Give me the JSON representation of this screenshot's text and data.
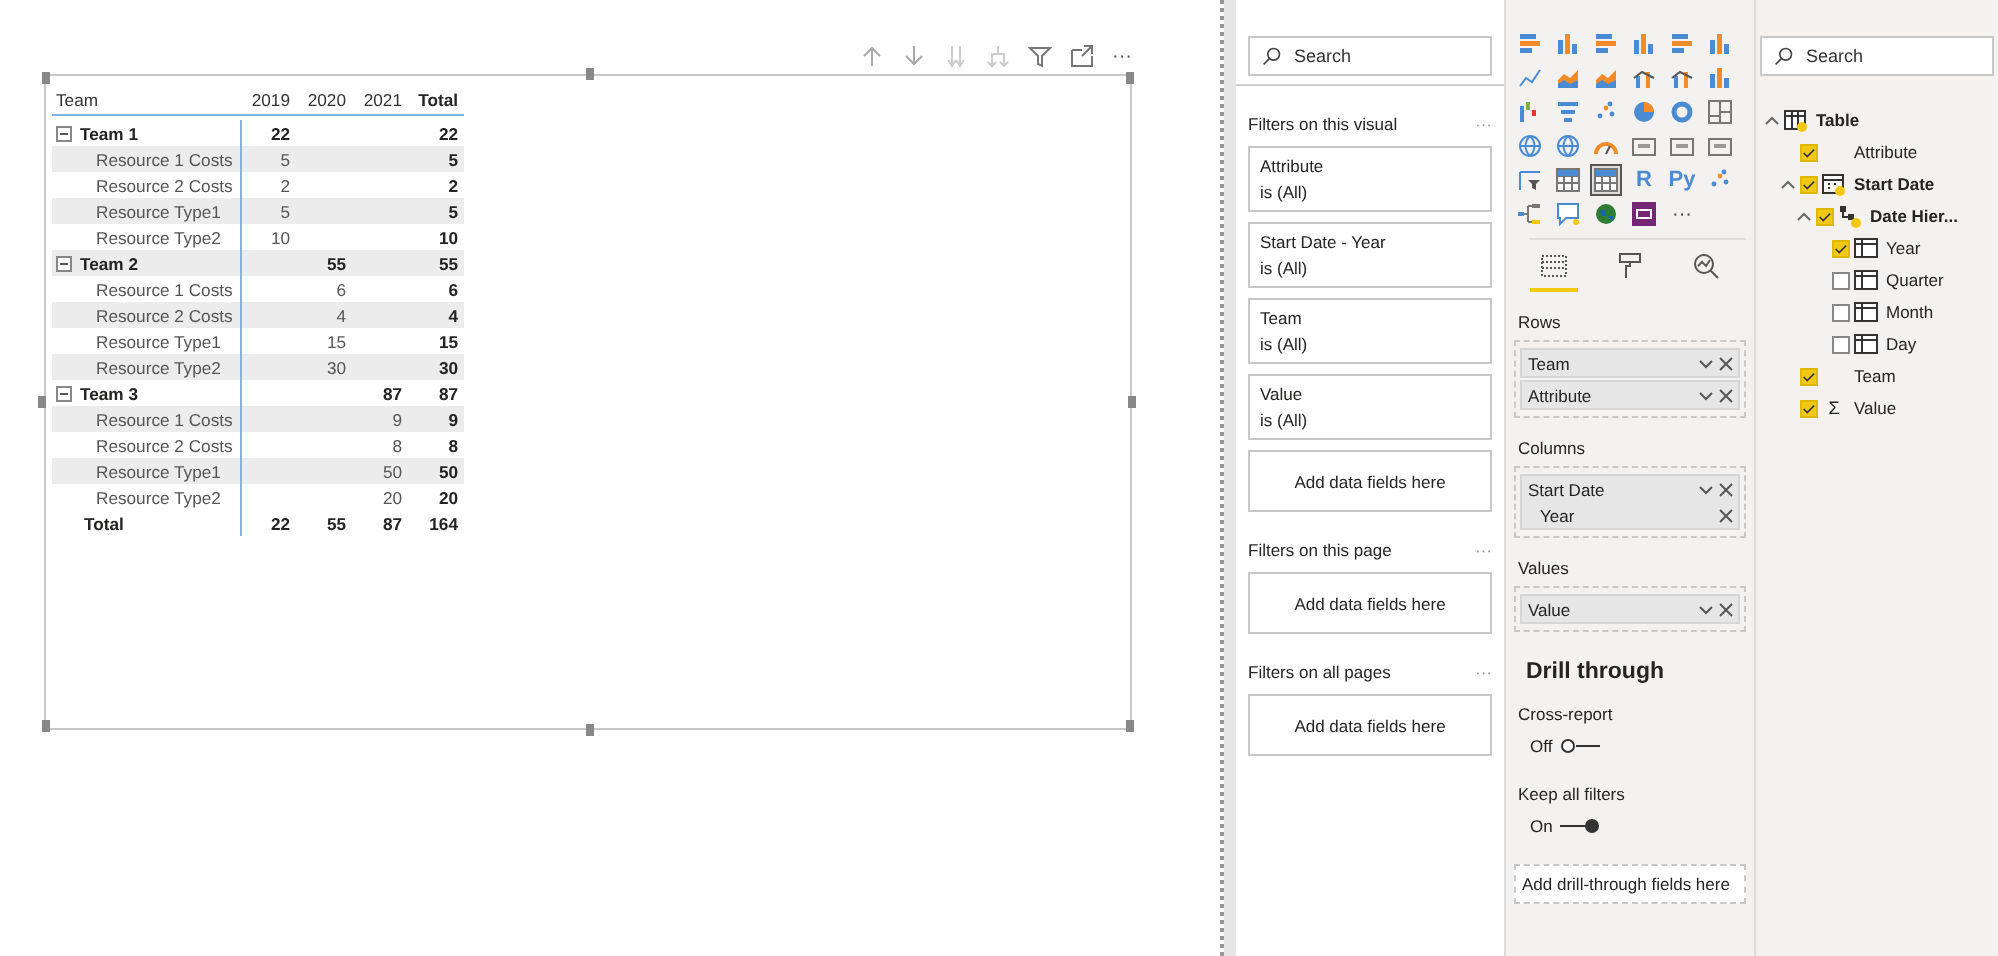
{
  "visual_header": [
    {
      "kind": "up"
    },
    {
      "kind": "down"
    },
    {
      "kind": "double-down"
    },
    {
      "kind": "fork"
    },
    {
      "kind": "filter"
    },
    {
      "kind": "focus"
    },
    {
      "kind": "more",
      "label": "···"
    }
  ],
  "matrix": {
    "columns": [
      "Team",
      "2019",
      "2020",
      "2021",
      "Total"
    ],
    "rows": [
      {
        "kind": "group",
        "label": "Team 1",
        "expanded": true,
        "values": {
          "col_1": "22",
          "total": "22"
        }
      },
      {
        "kind": "item",
        "label": "Resource 1 Costs",
        "values": {
          "col_1": "5",
          "total": "5"
        }
      },
      {
        "kind": "item",
        "label": "Resource 2 Costs",
        "values": {
          "col_1": "2",
          "total": "2"
        }
      },
      {
        "kind": "item",
        "label": "Resource Type1",
        "values": {
          "col_1": "5",
          "total": "5"
        }
      },
      {
        "kind": "item",
        "label": "Resource Type2",
        "values": {
          "col_1": "10",
          "total": "10"
        }
      },
      {
        "kind": "group",
        "label": "Team 2",
        "expanded": true,
        "values": {
          "col_2": "55",
          "total": "55"
        }
      },
      {
        "kind": "item",
        "label": "Resource 1 Costs",
        "values": {
          "col_2": "6",
          "total": "6"
        }
      },
      {
        "kind": "item",
        "label": "Resource 2 Costs",
        "values": {
          "col_2": "4",
          "total": "4"
        }
      },
      {
        "kind": "item",
        "label": "Resource Type1",
        "values": {
          "col_2": "15",
          "total": "15"
        }
      },
      {
        "kind": "item",
        "label": "Resource Type2",
        "values": {
          "col_2": "30",
          "total": "30"
        }
      },
      {
        "kind": "group",
        "label": "Team 3",
        "expanded": true,
        "values": {
          "col_3": "87",
          "total": "87"
        }
      },
      {
        "kind": "item",
        "label": "Resource 1 Costs",
        "values": {
          "col_3": "9",
          "total": "9"
        }
      },
      {
        "kind": "item",
        "label": "Resource 2 Costs",
        "values": {
          "col_3": "8",
          "total": "8"
        }
      },
      {
        "kind": "item",
        "label": "Resource Type1",
        "values": {
          "col_3": "50",
          "total": "50"
        }
      },
      {
        "kind": "item",
        "label": "Resource Type2",
        "values": {
          "col_3": "20",
          "total": "20"
        }
      },
      {
        "kind": "total",
        "label": "Total",
        "values": {
          "col_1": "22",
          "col_2": "55",
          "col_3": "87",
          "total": "164"
        }
      }
    ]
  },
  "filters": {
    "search": {
      "placeholder": "Search"
    },
    "sections": [
      {
        "title": "Filters on this visual",
        "more": "···",
        "cards": [
          {
            "name": "Attribute",
            "state": "is (All)"
          },
          {
            "name": "Start Date - Year",
            "state": "is (All)"
          },
          {
            "name": "Team",
            "state": "is (All)"
          },
          {
            "name": "Value",
            "state": "is (All)"
          }
        ],
        "add": "Add data fields here"
      },
      {
        "title": "Filters on this page",
        "more": "···",
        "add": "Add data fields here"
      },
      {
        "title": "Filters on all pages",
        "more": "···",
        "add": "Add data fields here"
      }
    ]
  },
  "visualizations": {
    "types": [
      {
        "kind": "hbar",
        "selected": false
      },
      {
        "kind": "column",
        "selected": false
      },
      {
        "kind": "hbar",
        "selected": false
      },
      {
        "kind": "column",
        "selected": false
      },
      {
        "kind": "hbar",
        "selected": false
      },
      {
        "kind": "column",
        "selected": false
      },
      {
        "kind": "line",
        "selected": false
      },
      {
        "kind": "area",
        "selected": false
      },
      {
        "kind": "area",
        "selected": false
      },
      {
        "kind": "combo",
        "selected": false
      },
      {
        "kind": "combo",
        "selected": false
      },
      {
        "kind": "column",
        "selected": false
      },
      {
        "kind": "waterfall",
        "selected": false
      },
      {
        "kind": "funnel",
        "selected": false
      },
      {
        "kind": "scatter",
        "selected": false
      },
      {
        "kind": "pie",
        "selected": false
      },
      {
        "kind": "donut",
        "selected": false
      },
      {
        "kind": "treemap",
        "selected": false
      },
      {
        "kind": "map",
        "selected": false
      },
      {
        "kind": "map",
        "selected": false
      },
      {
        "kind": "gauge",
        "selected": false
      },
      {
        "kind": "card",
        "selected": false
      },
      {
        "kind": "card",
        "selected": false
      },
      {
        "kind": "card",
        "selected": false
      },
      {
        "kind": "slicer",
        "selected": false
      },
      {
        "kind": "table",
        "selected": false
      },
      {
        "kind": "table",
        "selected": true
      },
      {
        "kind": "text",
        "label": "R",
        "selected": false
      },
      {
        "kind": "text",
        "label": "Py",
        "selected": false
      },
      {
        "kind": "scatter",
        "selected": false
      },
      {
        "kind": "tree",
        "selected": false
      },
      {
        "kind": "chat",
        "selected": false
      },
      {
        "kind": "globe",
        "selected": false
      },
      {
        "kind": "custom",
        "selected": false
      },
      {
        "kind": "more",
        "label": "···",
        "selected": false
      }
    ],
    "tabs": [
      {
        "kind": "fields",
        "selected": true
      },
      {
        "kind": "format",
        "selected": false
      },
      {
        "kind": "analytics",
        "selected": false
      }
    ],
    "wells": [
      {
        "title": "Rows",
        "fields": [
          {
            "name": "Team"
          },
          {
            "name": "Attribute"
          }
        ]
      },
      {
        "title": "Columns",
        "fields": [
          {
            "name": "Start Date",
            "sub": "Year"
          }
        ]
      },
      {
        "title": "Values",
        "fields": [
          {
            "name": "Value"
          }
        ]
      }
    ],
    "drill_through": {
      "title": "Drill through",
      "toggles": [
        {
          "label": "Cross-report",
          "state": "Off",
          "on": false
        },
        {
          "label": "Keep all filters",
          "state": "On",
          "on": true
        }
      ],
      "add": "Add drill-through fields here"
    }
  },
  "fields": {
    "search": {
      "placeholder": "Search"
    },
    "tree": [
      {
        "kind": "table",
        "label": "Table",
        "expanded": true,
        "children": [
          {
            "kind": "field",
            "label": "Attribute",
            "checked": true
          },
          {
            "kind": "date",
            "label": "Start Date",
            "checked": true,
            "expanded": true,
            "children": [
              {
                "kind": "hierarchy",
                "label": "Date Hier...",
                "checked": true,
                "expanded": true,
                "children": [
                  {
                    "kind": "level",
                    "label": "Year",
                    "checked": true
                  },
                  {
                    "kind": "level",
                    "label": "Quarter",
                    "checked": false
                  },
                  {
                    "kind": "level",
                    "label": "Month",
                    "checked": false
                  },
                  {
                    "kind": "level",
                    "label": "Day",
                    "checked": false
                  }
                ]
              }
            ]
          },
          {
            "kind": "field",
            "label": "Team",
            "checked": true
          },
          {
            "kind": "measure",
            "label": "Value",
            "sigma": "Σ",
            "checked": true
          }
        ]
      }
    ]
  }
}
